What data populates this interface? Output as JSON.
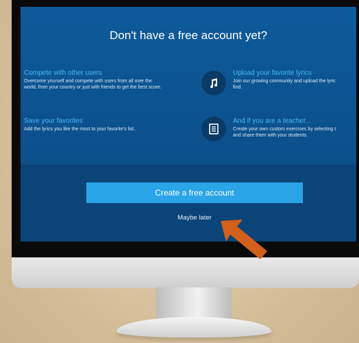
{
  "modal": {
    "heading": "Don't have a free account yet?",
    "features": [
      {
        "title": "Compete with other users",
        "desc_line1": "Overcome yourself and compete with users from all over the",
        "desc_line2": "world, from your country or just with friends to get the best score."
      },
      {
        "title": "Upload your favorite lyrics",
        "desc_line1": "Join our growing community and upload the lyric",
        "desc_line2": "find.",
        "icon": "music-note-icon"
      },
      {
        "title": "Save your favorites",
        "desc_line1": "Add the lyrics you like the most to your favorite's list.",
        "desc_line2": ""
      },
      {
        "title": "And if you are a teacher...",
        "desc_line1": "Create your own custom exercises by selecting t",
        "desc_line2": "and share them with your students.",
        "icon": "document-list-icon"
      }
    ],
    "cta_label": "Create a free account",
    "later_label": "Maybe later"
  },
  "colors": {
    "screen_bg": "#0c4f8a",
    "title_blue": "#4cb8f5",
    "button_blue": "#2aa5e8",
    "arrow_orange": "#d2601a",
    "backdrop": "#d9c5a0"
  }
}
